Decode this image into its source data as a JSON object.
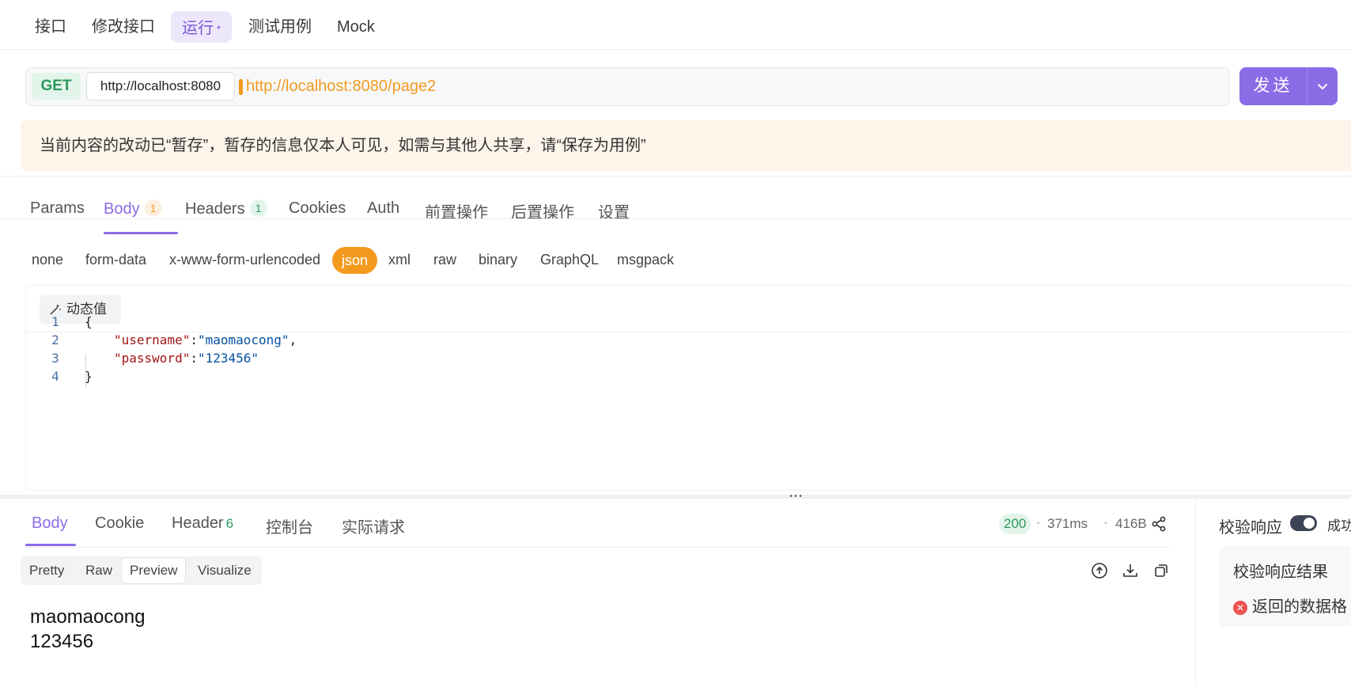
{
  "top_tabs": [
    {
      "label": "接口"
    },
    {
      "label": "修改接口"
    },
    {
      "label": "运行",
      "dot": "•"
    },
    {
      "label": "测试用例"
    },
    {
      "label": "Mock"
    }
  ],
  "request": {
    "method": "GET",
    "base_url": "http://localhost:8080",
    "url": "http://localhost:8080/page2",
    "send_label": "发送"
  },
  "notice": "当前内容的改动已“暂存”，暂存的信息仅本人可见，如需与其他人共享，请“保存为用例”",
  "request_tabs": [
    {
      "label": "Params"
    },
    {
      "label": "Body",
      "badge": "1"
    },
    {
      "label": "Headers",
      "badge": "1"
    },
    {
      "label": "Cookies"
    },
    {
      "label": "Auth"
    },
    {
      "label": "前置操作"
    },
    {
      "label": "后置操作"
    },
    {
      "label": "设置"
    }
  ],
  "body_types": [
    "none",
    "form-data",
    "x-www-form-urlencoded",
    "json",
    "xml",
    "raw",
    "binary",
    "GraphQL",
    "msgpack"
  ],
  "dynamic_button": "动态值",
  "code": {
    "line_numbers": [
      "1",
      "2",
      "3",
      "4"
    ],
    "open_brace": "{",
    "close_brace": "}",
    "key1": "\"username\"",
    "val1": "\"maomaocong\"",
    "key2": "\"password\"",
    "val2": "\"123456\""
  },
  "response_tabs": [
    {
      "label": "Body"
    },
    {
      "label": "Cookie"
    },
    {
      "label": "Header",
      "badge": "6"
    },
    {
      "label": "控制台"
    },
    {
      "label": "实际请求"
    }
  ],
  "response_meta": {
    "status": "200",
    "time": "371ms",
    "size": "416B"
  },
  "view_modes": [
    "Pretty",
    "Raw",
    "Preview",
    "Visualize"
  ],
  "preview_lines": [
    "maomaocong",
    "123456"
  ],
  "validation": {
    "label": "校验响应",
    "toggle_on": true,
    "status": "成功",
    "result_title": "校验响应结果",
    "result_error": "返回的数据格"
  },
  "colors": {
    "accent": "#8b6ce6",
    "url": "#f39a1e",
    "success": "#2b9a5b",
    "error": "#ef5350"
  }
}
